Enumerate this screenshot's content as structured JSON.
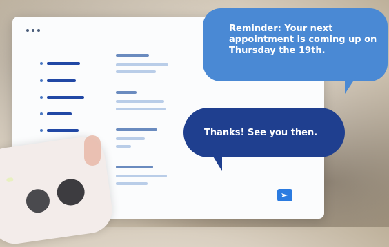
{
  "window": {
    "dots_icon": "window-dots-icon"
  },
  "messages": {
    "incoming": {
      "text": "Reminder: Your next appointment is coming up on Thursday the 19th.",
      "color": "#4a89d4"
    },
    "outgoing": {
      "text": "Thanks! See you then.",
      "color": "#1f3f8f"
    }
  },
  "composer": {
    "send_icon": "send-arrow-icon",
    "button_color": "#2b7be0"
  },
  "colors": {
    "menu_bar": "#2148a5",
    "text_line_dark": "#6a8bbf",
    "text_line_light": "#b9cde8",
    "card": "#fbfcfd"
  }
}
